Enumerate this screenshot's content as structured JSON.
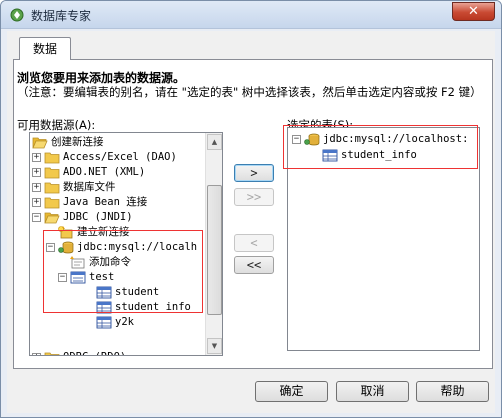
{
  "window": {
    "title": "数据库专家",
    "close_glyph": "✕"
  },
  "tabs": [
    {
      "label": "数据"
    }
  ],
  "instructions": {
    "heading": "浏览您要用来添加表的数据源。",
    "note": "（注意：要编辑表的别名，请在 \"选定的表\" 树中选择该表，然后单击选定内容或按 F2 键）"
  },
  "available": {
    "label": "可用数据源(A):",
    "items": [
      {
        "text": "创建新连接",
        "toggle": "",
        "icon": "folder-open-icon"
      },
      {
        "text": "Access/Excel (DAO)",
        "toggle": "+",
        "icon": "folder-icon"
      },
      {
        "text": "ADO.NET (XML)",
        "toggle": "+",
        "icon": "folder-icon"
      },
      {
        "text": "数据库文件",
        "toggle": "+",
        "icon": "folder-icon"
      },
      {
        "text": "Java Bean 连接",
        "toggle": "+",
        "icon": "folder-icon"
      },
      {
        "text": "JDBC (JNDI)",
        "toggle": "−",
        "icon": "folder-open-icon"
      },
      {
        "text": "建立新连接",
        "toggle": "",
        "icon": "new-connection-icon"
      },
      {
        "text": "jdbc:mysql://localh",
        "toggle": "−",
        "icon": "database-connection-icon"
      },
      {
        "text": "添加命令",
        "toggle": "",
        "icon": "add-command-icon"
      },
      {
        "text": "test",
        "toggle": "−",
        "icon": "schema-icon"
      },
      {
        "text": "student",
        "toggle": "",
        "icon": "table-icon"
      },
      {
        "text": "student_info",
        "toggle": "",
        "icon": "table-icon"
      },
      {
        "text": "y2k",
        "toggle": "",
        "icon": "table-icon"
      },
      {
        "text": "ODBC (RDO)",
        "toggle": "+",
        "icon": "folder-icon"
      }
    ]
  },
  "selected": {
    "label": "选定的表(S):",
    "items": [
      {
        "text": "jdbc:mysql://localhost:",
        "toggle": "−",
        "icon": "database-connection-icon"
      },
      {
        "text": "student_info",
        "toggle": "",
        "icon": "table-icon"
      }
    ]
  },
  "move_buttons": {
    "add_one": ">",
    "add_all": ">>",
    "remove_one": "<",
    "remove_all": "<<"
  },
  "dialog_buttons": {
    "ok": "确定",
    "cancel": "取消",
    "help": "帮助"
  },
  "colors": {
    "highlight_border": "#e33333",
    "folder": "#f2c94c"
  }
}
